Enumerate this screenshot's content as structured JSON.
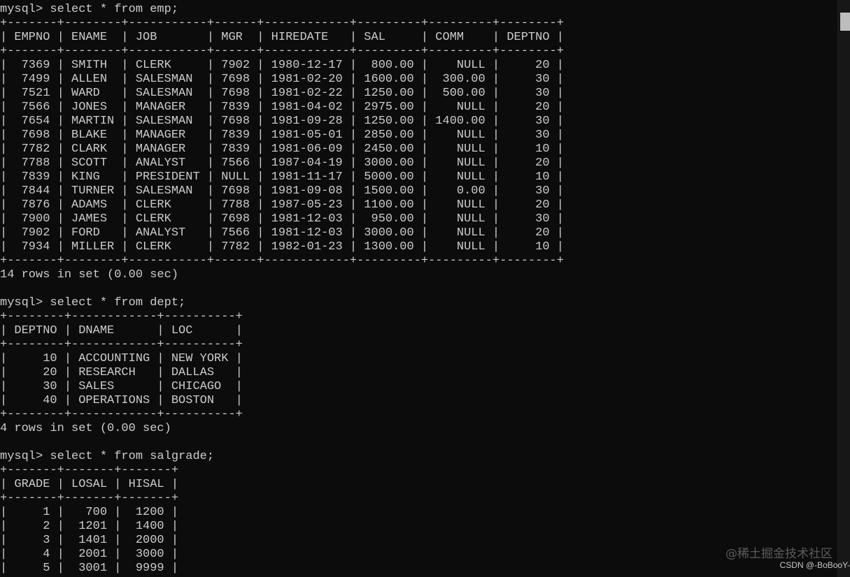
{
  "terminal": {
    "lines": [
      "mysql> select * from emp;",
      "+-------+--------+-----------+------+------------+---------+---------+--------+",
      "| EMPNO | ENAME  | JOB       | MGR  | HIREDATE   | SAL     | COMM    | DEPTNO |",
      "+-------+--------+-----------+------+------------+---------+---------+--------+",
      "|  7369 | SMITH  | CLERK     | 7902 | 1980-12-17 |  800.00 |    NULL |     20 |",
      "|  7499 | ALLEN  | SALESMAN  | 7698 | 1981-02-20 | 1600.00 |  300.00 |     30 |",
      "|  7521 | WARD   | SALESMAN  | 7698 | 1981-02-22 | 1250.00 |  500.00 |     30 |",
      "|  7566 | JONES  | MANAGER   | 7839 | 1981-04-02 | 2975.00 |    NULL |     20 |",
      "|  7654 | MARTIN | SALESMAN  | 7698 | 1981-09-28 | 1250.00 | 1400.00 |     30 |",
      "|  7698 | BLAKE  | MANAGER   | 7839 | 1981-05-01 | 2850.00 |    NULL |     30 |",
      "|  7782 | CLARK  | MANAGER   | 7839 | 1981-06-09 | 2450.00 |    NULL |     10 |",
      "|  7788 | SCOTT  | ANALYST   | 7566 | 1987-04-19 | 3000.00 |    NULL |     20 |",
      "|  7839 | KING   | PRESIDENT | NULL | 1981-11-17 | 5000.00 |    NULL |     10 |",
      "|  7844 | TURNER | SALESMAN  | 7698 | 1981-09-08 | 1500.00 |    0.00 |     30 |",
      "|  7876 | ADAMS  | CLERK     | 7788 | 1987-05-23 | 1100.00 |    NULL |     20 |",
      "|  7900 | JAMES  | CLERK     | 7698 | 1981-12-03 |  950.00 |    NULL |     30 |",
      "|  7902 | FORD   | ANALYST   | 7566 | 1981-12-03 | 3000.00 |    NULL |     20 |",
      "|  7934 | MILLER | CLERK     | 7782 | 1982-01-23 | 1300.00 |    NULL |     10 |",
      "+-------+--------+-----------+------+------------+---------+---------+--------+",
      "14 rows in set (0.00 sec)",
      "",
      "mysql> select * from dept;",
      "+--------+------------+----------+",
      "| DEPTNO | DNAME      | LOC      |",
      "+--------+------------+----------+",
      "|     10 | ACCOUNTING | NEW YORK |",
      "|     20 | RESEARCH   | DALLAS   |",
      "|     30 | SALES      | CHICAGO  |",
      "|     40 | OPERATIONS | BOSTON   |",
      "+--------+------------+----------+",
      "4 rows in set (0.00 sec)",
      "",
      "mysql> select * from salgrade;",
      "+-------+-------+-------+",
      "| GRADE | LOSAL | HISAL |",
      "+-------+-------+-------+",
      "|     1 |   700 |  1200 |",
      "|     2 |  1201 |  1400 |",
      "|     3 |  1401 |  2000 |",
      "|     4 |  2001 |  3000 |",
      "|     5 |  3001 |  9999 |"
    ]
  },
  "watermark": {
    "main": "@稀土掘金技术社区",
    "sub": "CSDN @-BoBooY-"
  },
  "colors": {
    "background": "#0c0c0c",
    "text": "#cccccc",
    "scrollbar_track": "#171717",
    "scrollbar_thumb": "#bdbdbd"
  }
}
